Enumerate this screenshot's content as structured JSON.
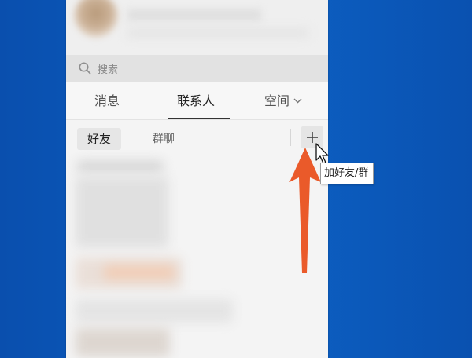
{
  "search": {
    "placeholder": "搜索",
    "icon": "search-icon"
  },
  "tabs": [
    {
      "label": "消息",
      "active": false
    },
    {
      "label": "联系人",
      "active": true
    },
    {
      "label": "空间",
      "active": false,
      "has_dropdown": true
    }
  ],
  "subtabs": [
    {
      "label": "好友",
      "active": true
    },
    {
      "label": "群聊",
      "active": false
    }
  ],
  "add_button": {
    "icon": "plus-icon",
    "tooltip": "加好友/群"
  },
  "colors": {
    "desktop_bg": "#0a57b8",
    "panel_bg": "#f4f4f4",
    "search_bg": "#e2e2e2",
    "arrow": "#ea5a2a",
    "tooltip_bg": "#ffffff"
  }
}
